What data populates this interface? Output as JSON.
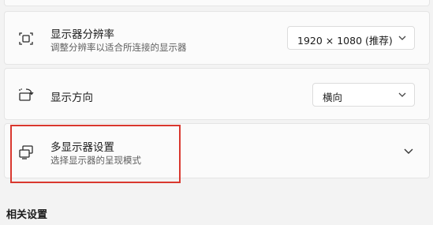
{
  "resolution": {
    "title": "显示器分辨率",
    "subtitle": "调整分辨率以适合所连接的显示器",
    "selected": "1920 × 1080 (推荐)",
    "icon": "resolution-icon"
  },
  "orientation": {
    "title": "显示方向",
    "selected": "横向",
    "icon": "rotate-screen-icon"
  },
  "multi_display": {
    "title": "多显示器设置",
    "subtitle": "选择显示器的呈现模式",
    "icon": "multi-monitor-icon"
  },
  "related": {
    "title": "相关设置"
  },
  "colors": {
    "highlight": "#d9382f",
    "background": "#f3f3f3",
    "card": "#fbfbfb"
  }
}
